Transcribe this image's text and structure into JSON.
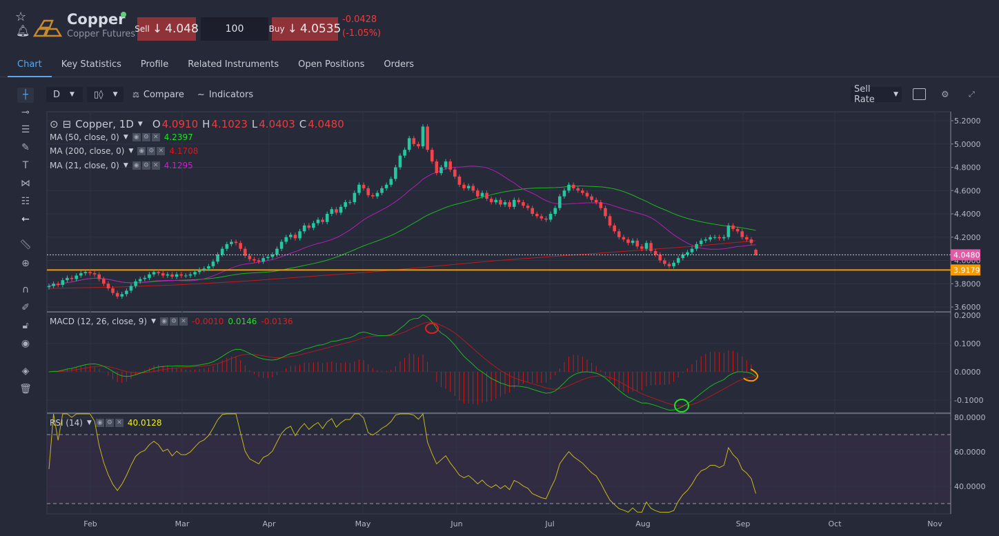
{
  "header": {
    "title": "Copper",
    "subtitle": "Copper Futures",
    "status_color": "#5fcf7a",
    "sell": {
      "label": "Sell",
      "arrow": "↓",
      "price": "4.048"
    },
    "quantity": "100",
    "buy": {
      "label": "Buy",
      "arrow": "↓",
      "price": "4.0535"
    },
    "change": "-0.0428",
    "change_pct": "(-1.05%)"
  },
  "tabs": [
    {
      "label": "Chart",
      "active": true
    },
    {
      "label": "Key Statistics"
    },
    {
      "label": "Profile"
    },
    {
      "label": "Related Instruments"
    },
    {
      "label": "Open Positions"
    },
    {
      "label": "Orders"
    }
  ],
  "toolbar": {
    "interval": "D",
    "compare": "Compare",
    "indicators": "Indicators",
    "rate": "Sell Rate"
  },
  "legend": {
    "symbol": "Copper, 1D",
    "o_label": "O",
    "o": "4.0910",
    "h_label": "H",
    "h": "4.1023",
    "l_label": "L",
    "l": "4.0403",
    "c_label": "C",
    "c": "4.0480",
    "ma50": {
      "label": "MA (50, close, 0)",
      "value": "4.2397",
      "color": "#22e022"
    },
    "ma200": {
      "label": "MA (200, close, 0)",
      "value": "4.1708",
      "color": "#d21c1c"
    },
    "ma21": {
      "label": "MA (21, close, 0)",
      "value": "4.1295",
      "color": "#d21cd2"
    },
    "macd": {
      "label": "MACD (12, 26, close, 9)",
      "hist": "-0.0010",
      "macd": "0.0146",
      "signal": "-0.0136"
    },
    "rsi": {
      "label": "RSI (14)",
      "value": "40.0128"
    }
  },
  "chart_data": {
    "type": "candlestick",
    "symbol": "Copper",
    "interval": "1D",
    "closes": [
      3.78,
      3.8,
      3.79,
      3.83,
      3.85,
      3.84,
      3.87,
      3.89,
      3.9,
      3.89,
      3.88,
      3.84,
      3.8,
      3.76,
      3.72,
      3.69,
      3.71,
      3.74,
      3.78,
      3.82,
      3.84,
      3.85,
      3.88,
      3.9,
      3.89,
      3.87,
      3.88,
      3.86,
      3.88,
      3.87,
      3.87,
      3.88,
      3.9,
      3.92,
      3.93,
      3.95,
      3.99,
      4.05,
      4.1,
      4.14,
      4.16,
      4.15,
      4.1,
      4.04,
      4.01,
      4.0,
      3.99,
      4.02,
      4.03,
      4.05,
      4.1,
      4.16,
      4.2,
      4.22,
      4.19,
      4.25,
      4.3,
      4.28,
      4.32,
      4.35,
      4.33,
      4.4,
      4.44,
      4.41,
      4.46,
      4.5,
      4.5,
      4.58,
      4.65,
      4.62,
      4.56,
      4.55,
      4.58,
      4.62,
      4.65,
      4.7,
      4.8,
      4.9,
      4.95,
      5.05,
      5.0,
      4.98,
      5.15,
      4.95,
      4.85,
      4.75,
      4.8,
      4.85,
      4.78,
      4.72,
      4.65,
      4.62,
      4.64,
      4.6,
      4.55,
      4.58,
      4.53,
      4.5,
      4.52,
      4.48,
      4.5,
      4.46,
      4.52,
      4.5,
      4.47,
      4.45,
      4.4,
      4.38,
      4.36,
      4.35,
      4.4,
      4.45,
      4.55,
      4.6,
      4.65,
      4.62,
      4.6,
      4.58,
      4.55,
      4.52,
      4.5,
      4.45,
      4.38,
      4.3,
      4.25,
      4.2,
      4.18,
      4.15,
      4.17,
      4.12,
      4.1,
      4.15,
      4.08,
      4.05,
      4.0,
      3.97,
      3.95,
      3.98,
      4.02,
      4.05,
      4.07,
      4.1,
      4.14,
      4.17,
      4.18,
      4.2,
      4.2,
      4.19,
      4.2,
      4.3,
      4.27,
      4.25,
      4.2,
      4.18,
      4.15,
      4.048
    ],
    "last_candle": {
      "open": 4.091,
      "high": 4.1023,
      "low": 4.0403,
      "close": 4.048
    },
    "ma200_samples": [
      3.76,
      3.77,
      3.79,
      3.82,
      3.86,
      3.9,
      3.95,
      4.0,
      4.04,
      4.08,
      4.12,
      4.17
    ],
    "horizontal_line": {
      "value": 3.9179,
      "label": "3.9179",
      "color": "#f59a00"
    },
    "last_price_label": "4.0480",
    "last_price_color": "#e05aa5",
    "up_color": "#26c6a0",
    "down_color": "#f0444a",
    "price_axis": {
      "ticks": [
        "5.2000",
        "5.0000",
        "4.8000",
        "4.6000",
        "4.4000",
        "4.2000",
        "4.0000",
        "3.8000",
        "3.6000"
      ],
      "range": [
        3.58,
        5.25
      ]
    },
    "macd_axis": {
      "ticks": [
        "0.2000",
        "0.1000",
        "0.0000",
        "-0.1000"
      ]
    },
    "rsi_axis": {
      "ticks": [
        "80.0000",
        "60.0000",
        "40.0000"
      ],
      "bands": [
        30,
        70
      ]
    },
    "x_ticks": [
      "Feb",
      "Mar",
      "Apr",
      "May",
      "Jun",
      "Jul",
      "Aug",
      "Sep",
      "Oct",
      "Nov"
    ],
    "grid": true
  }
}
